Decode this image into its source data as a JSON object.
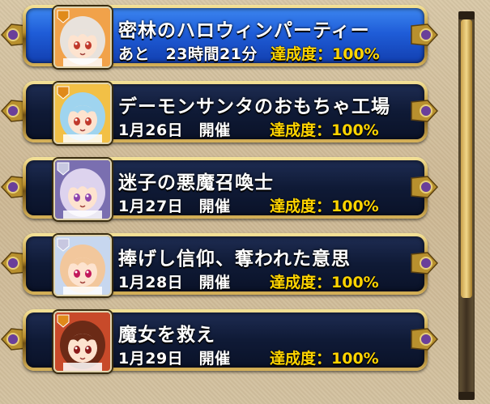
{
  "events": [
    {
      "title": "密林のハロウィンパーティー",
      "date": "あと　23時間21分",
      "achievement": "達成度：100%",
      "active": true,
      "portrait": {
        "bg": "#f1a24a",
        "hair": "#e8e2dc",
        "eyes": "#c0392b",
        "badge": "#e08a1a"
      }
    },
    {
      "title": "デーモンサンタのおもちゃ工場",
      "date": "1月26日　開催",
      "achievement": "達成度：100%",
      "active": false,
      "portrait": {
        "bg": "#f2c046",
        "hair": "#9fd4ef",
        "eyes": "#c0392b",
        "badge": "#e08a1a"
      }
    },
    {
      "title": "迷子の悪魔召喚士",
      "date": "1月27日　開催",
      "achievement": "達成度：100%",
      "active": false,
      "portrait": {
        "bg": "#7a6fb0",
        "hair": "#ddd3ee",
        "eyes": "#8e44ad",
        "badge": "#c7c7e0"
      }
    },
    {
      "title": "捧げし信仰、奪われた意思",
      "date": "1月28日　開催",
      "achievement": "達成度：100%",
      "active": false,
      "portrait": {
        "bg": "#c7d7ef",
        "hair": "#f2c79c",
        "eyes": "#c2185b",
        "badge": "#c7c7e0"
      }
    },
    {
      "title": "魔女を救え",
      "date": "1月29日　開催",
      "achievement": "達成度：100%",
      "active": false,
      "portrait": {
        "bg": "#c84a2a",
        "hair": "#6b2a16",
        "eyes": "#8b1a1a",
        "badge": "#e08a1a"
      }
    }
  ]
}
